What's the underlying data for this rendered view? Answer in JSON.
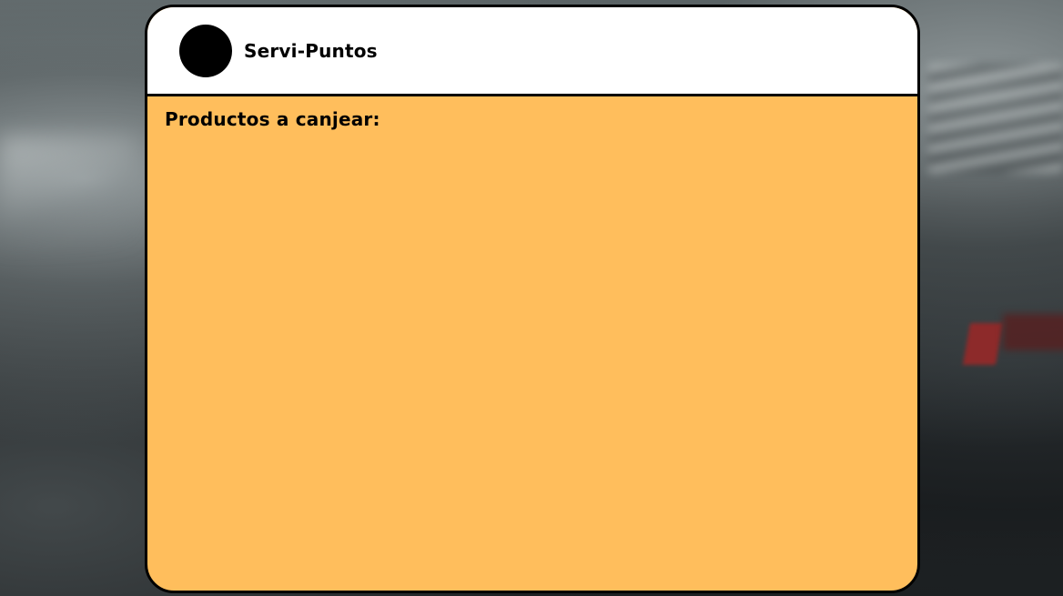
{
  "app": {
    "brand_name": "Servi-Puntos",
    "logo_icon": "logo-circle"
  },
  "main": {
    "section_title": "Productos a canjear:",
    "products": []
  },
  "colors": {
    "card_background": "#ffbe5c",
    "header_background": "#ffffff",
    "border": "#000000",
    "logo": "#000000"
  }
}
